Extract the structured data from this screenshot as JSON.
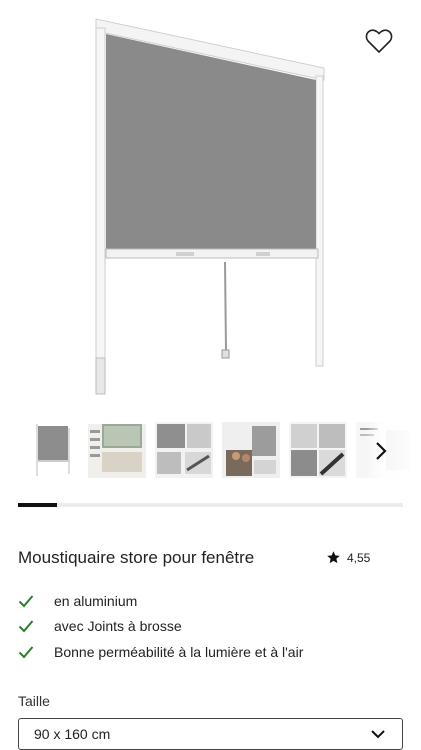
{
  "product": {
    "title": "Moustiquaire store pour fenêtre",
    "rating": "4,55",
    "features": [
      "en aluminium",
      "avec Joints à brosse",
      "Bonne perméabilité à la lumière et à l'air"
    ]
  },
  "gallery": {
    "progress": 0.1,
    "thumbnails": [
      "thumbnail-window-screen",
      "thumbnail-interior-scene",
      "thumbnail-detail-view",
      "thumbnail-family-scene",
      "thumbnail-frame-detail",
      "thumbnail-spec-sheet"
    ]
  },
  "size": {
    "label": "Taille",
    "selected": "90 x 160 cm"
  },
  "colors": {
    "check": "#2e7d32",
    "mesh": "#8a8a8a",
    "accent": "#111111"
  }
}
